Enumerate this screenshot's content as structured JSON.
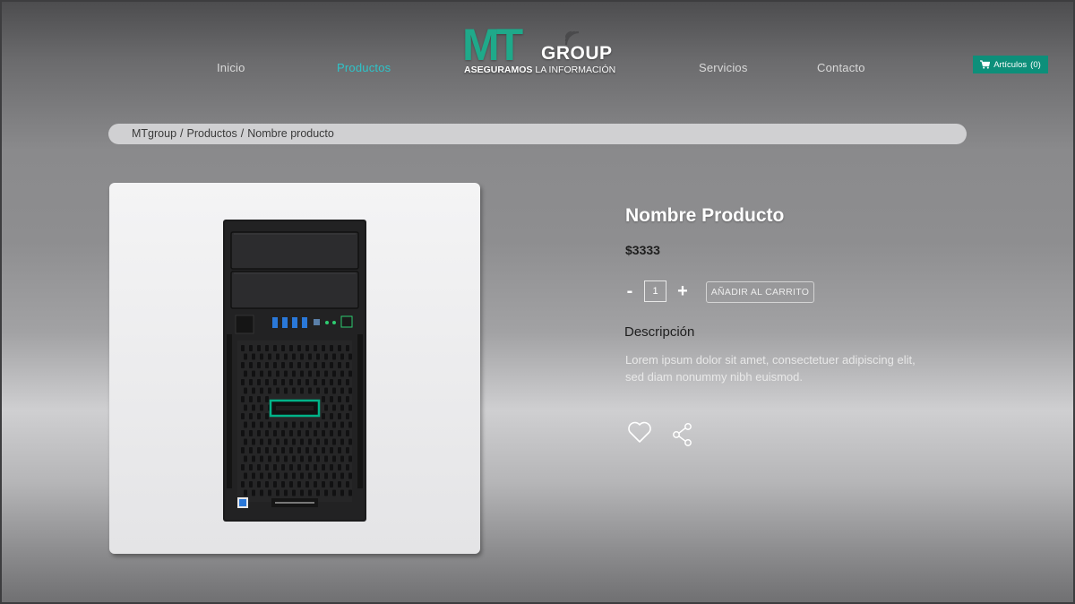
{
  "nav": {
    "items": [
      {
        "label": "Inicio"
      },
      {
        "label": "Productos",
        "active": true
      },
      {
        "label": "Servicios"
      },
      {
        "label": "Contacto"
      }
    ]
  },
  "logo": {
    "mark": "MT",
    "wordmark": "GROUP",
    "tagline_bold": "ASEGURAMOS",
    "tagline_rest": "LA INFORMACIÓN"
  },
  "cart": {
    "icon": "cart-icon",
    "label": "Artículos",
    "count": "(0)"
  },
  "breadcrumb": {
    "items": [
      "MTgroup",
      "Productos",
      "Nombre producto"
    ],
    "separator": "/"
  },
  "product": {
    "image_icon": "server-tower-image",
    "title": "Nombre Producto",
    "price": "$3333",
    "quantity": "1",
    "decrement_label": "-",
    "increment_label": "+",
    "add_to_cart_label": "AÑADIR AL CARRITO",
    "description_title": "Descripción",
    "description_text": "Lorem ipsum dolor sit amet, consectetuer adipiscing elit, sed diam nonummy nibh euismod."
  },
  "actions": {
    "favorite_icon": "heart-icon",
    "share_icon": "share-icon"
  },
  "colors": {
    "accent": "#2ec4c9",
    "brand_green": "#1fa98a",
    "cart_button": "#0d8f7a"
  }
}
